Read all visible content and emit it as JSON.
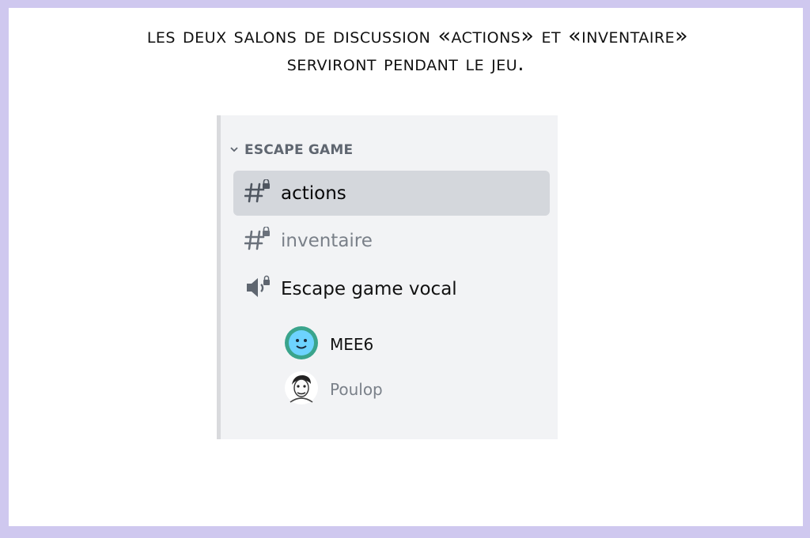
{
  "caption": {
    "line1": "Les deux salons de discussion «actions» et «inventaire»",
    "line2": "serviront pendant le jeu."
  },
  "sidebar": {
    "category": {
      "label": "ESCAPE GAME",
      "icon": "chevron-down-icon"
    },
    "channels": [
      {
        "label": "actions",
        "type": "text-locked",
        "icon": "hashtag-lock-icon",
        "selected": true
      },
      {
        "label": "inventaire",
        "type": "text-locked",
        "icon": "hashtag-lock-icon",
        "selected": false
      },
      {
        "label": "Escape game vocal",
        "type": "voice-locked",
        "icon": "speaker-lock-icon",
        "selected": false
      }
    ],
    "voice_users": [
      {
        "name": "MEE6",
        "avatar": "mee6-avatar"
      },
      {
        "name": "Poulop",
        "avatar": "sketch-portrait-avatar"
      }
    ]
  },
  "colors": {
    "border": "#cfc8ef",
    "panel_bg": "#f2f3f5",
    "selected_bg": "#d4d7dc",
    "muted_text": "#7a8089",
    "mee6_teal": "#3aa48c",
    "mee6_face": "#6dd3ff"
  }
}
